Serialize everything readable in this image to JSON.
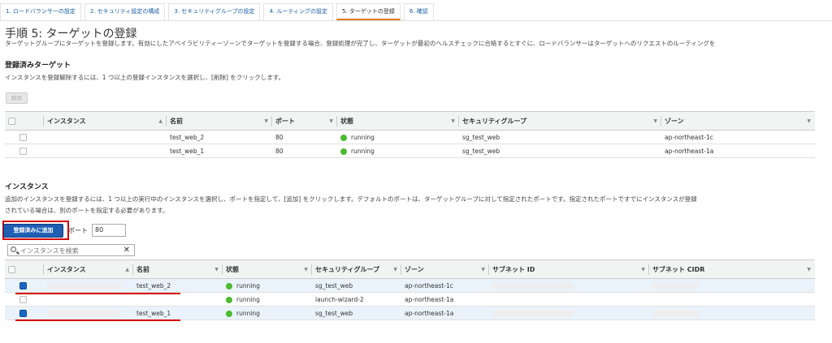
{
  "steps": [
    {
      "label": "1. ロードバランサーの設定"
    },
    {
      "label": "2. セキュリティ設定の構成"
    },
    {
      "label": "3. セキュリティグループの設定"
    },
    {
      "label": "4. ルーティングの設定"
    },
    {
      "label": "5. ターゲットの登録"
    },
    {
      "label": "6. 確認"
    }
  ],
  "page": {
    "title": "手順 5: ターゲットの登録",
    "description": "ターゲットグループにターゲットを登録します。有効にしたアベイラビリティーゾーンでターゲットを登録する場合、登録処理が完了し、ターゲットが最初のヘルスチェックに合格するとすぐに、ロードバランサーはターゲットへのリクエストのルーティングを"
  },
  "registered": {
    "heading": "登録済みターゲット",
    "subtext": "インスタンスを登録解除するには、1 つ以上の登録インスタンスを選択し、[削除] をクリックします。",
    "remove_label": "削除",
    "columns": [
      "インスタンス",
      "名前",
      "ポート",
      "状態",
      "セキュリティグループ",
      "ゾーン"
    ],
    "rows": [
      {
        "name": "test_web_2",
        "port": "80",
        "state": "running",
        "sg": "sg_test_web",
        "zone": "ap-northeast-1c"
      },
      {
        "name": "test_web_1",
        "port": "80",
        "state": "running",
        "sg": "sg_test_web",
        "zone": "ap-northeast-1a"
      }
    ]
  },
  "instances": {
    "heading": "インスタンス",
    "subtext_line1": "追加のインスタンスを登録するには、1 つ以上の実行中のインスタンスを選択し、ポートを指定して、[追加] をクリックします。デフォルトのポートは、ターゲットグループに対して指定されたポートです。指定されたポートですでにインスタンスが登録",
    "subtext_line2": "されている場合は、別のポートを指定する必要があります。",
    "add_label": "登録済みに追加",
    "port_label": "ポート",
    "port_value": "80",
    "search_placeholder": "インスタンスを検索",
    "columns": [
      "インスタンス",
      "名前",
      "状態",
      "セキュリティグループ",
      "ゾーン",
      "サブネット ID",
      "サブネット CIDR"
    ],
    "rows": [
      {
        "name": "test_web_2",
        "state": "running",
        "sg": "sg_test_web",
        "zone": "ap-northeast-1c",
        "selected": true
      },
      {
        "name": "",
        "state": "running",
        "sg": "launch-wizard-2",
        "zone": "ap-northeast-1a",
        "selected": false
      },
      {
        "name": "test_web_1",
        "state": "running",
        "sg": "sg_test_web",
        "zone": "ap-northeast-1a",
        "selected": true
      }
    ]
  },
  "colors": {
    "accent": "#1f5fb4",
    "highlight": "#d40000",
    "running": "#4cba2f"
  }
}
